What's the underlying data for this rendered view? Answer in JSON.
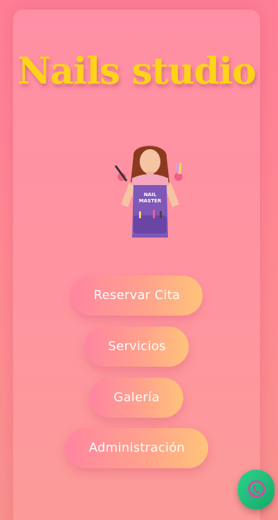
{
  "app": {
    "title": "Nails studio"
  },
  "hero": {
    "apron_line1": "NAIL",
    "apron_line2": "MASTER"
  },
  "menu": {
    "reservar": "Reservar Cita",
    "servicios": "Servicios",
    "galeria": "Galería",
    "administracion": "Administración"
  },
  "icons": {
    "floating": "whatsapp-icon"
  },
  "colors": {
    "title": "#ffd31a",
    "button_start": "#ff85a0",
    "button_end": "#ffc37a",
    "whatsapp": "#1fbe78"
  }
}
